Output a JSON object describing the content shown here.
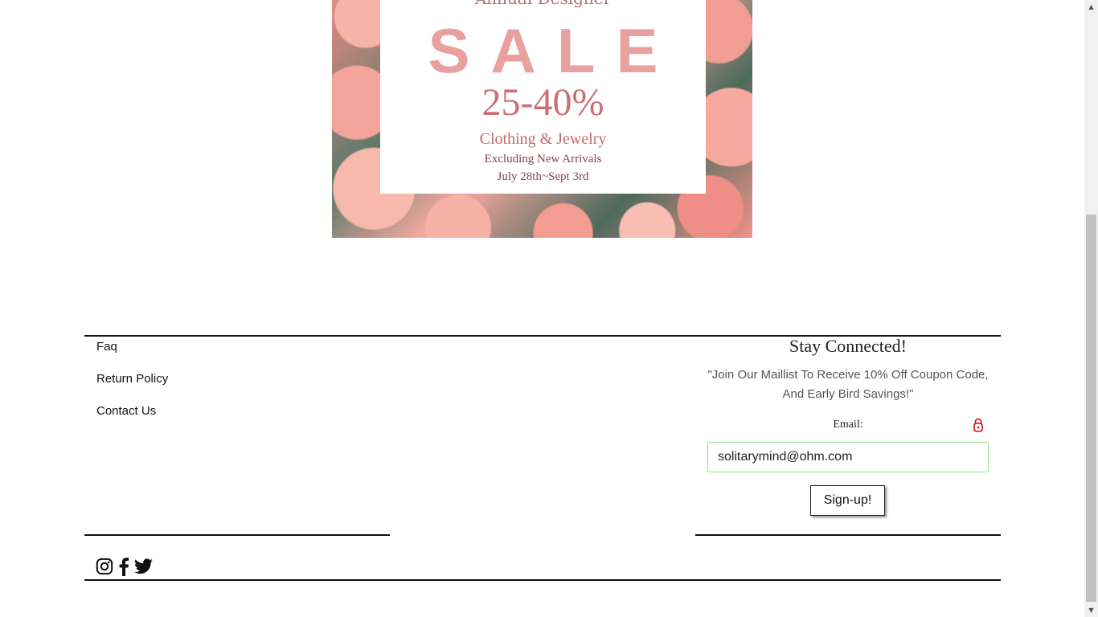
{
  "banner": {
    "pre_title": "Annual Designer",
    "sale": "SALE",
    "discount": "25-40%",
    "line1": "Clothing & Jewelry",
    "line2": "Excluding New Arrivals",
    "line3": "July 28th~Sept 3rd"
  },
  "footer": {
    "links": [
      "Faq",
      "Return Policy",
      "Contact Us"
    ]
  },
  "newsletter": {
    "title": "Stay Connected!",
    "blurb": "\"Join Our Maillist To Receive 10% Off Coupon Code, And Early Bird Savings!\"",
    "email_label": "Email:",
    "email_value": "solitarymind@ohm.com",
    "signup_label": "Sign-up!"
  },
  "social": {
    "icons": [
      "instagram-icon",
      "facebook-icon",
      "twitter-icon"
    ]
  },
  "colors": {
    "input_border": "#8ee08e",
    "lock_icon": "#d0021b",
    "rule": "#111111"
  }
}
